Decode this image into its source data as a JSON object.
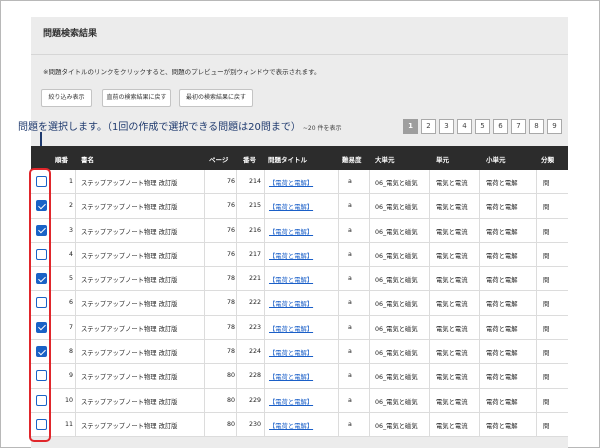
{
  "panel": {
    "title": "問題検索結果",
    "notice": "※問題タイトルのリンクをクリックすると、問題のプレビューが別ウィンドウで表示されます。",
    "buttons": {
      "filter": "絞り込み表示",
      "back_prev": "直前の検索結果に戻す",
      "back_first": "最初の検索結果に戻す"
    }
  },
  "callout": {
    "text": "問題を選択します。（1回の作成で選択できる問題は20問まで）",
    "count": "~20 件を表示"
  },
  "pager": [
    "1",
    "2",
    "3",
    "4",
    "5",
    "6",
    "7",
    "8",
    "9"
  ],
  "pager_active": "1",
  "table": {
    "headers": {
      "no": "順番",
      "book": "書名",
      "page": "ページ",
      "num": "番号",
      "title": "問題タイトル",
      "diff": "難易度",
      "major": "大単元",
      "unit": "単元",
      "minor": "小単元",
      "cls": "分類"
    },
    "rows": [
      {
        "checked": false,
        "no": "1",
        "book": "ステップアップノート物理 改訂版",
        "page": "76",
        "num": "214",
        "title": "【電荷と電解】",
        "diff": "a",
        "major": "06_電気と磁気",
        "unit": "電気と電流",
        "minor": "電荷と電解",
        "cls": "問"
      },
      {
        "checked": true,
        "no": "2",
        "book": "ステップアップノート物理 改訂版",
        "page": "76",
        "num": "215",
        "title": "【電荷と電解】",
        "diff": "a",
        "major": "06_電気と磁気",
        "unit": "電気と電流",
        "minor": "電荷と電解",
        "cls": "問"
      },
      {
        "checked": true,
        "no": "3",
        "book": "ステップアップノート物理 改訂版",
        "page": "76",
        "num": "216",
        "title": "【電荷と電解】",
        "diff": "a",
        "major": "06_電気と磁気",
        "unit": "電気と電流",
        "minor": "電荷と電解",
        "cls": "問"
      },
      {
        "checked": false,
        "no": "4",
        "book": "ステップアップノート物理 改訂版",
        "page": "76",
        "num": "217",
        "title": "【電荷と電解】",
        "diff": "a",
        "major": "06_電気と磁気",
        "unit": "電気と電流",
        "minor": "電荷と電解",
        "cls": "問"
      },
      {
        "checked": true,
        "no": "5",
        "book": "ステップアップノート物理 改訂版",
        "page": "78",
        "num": "221",
        "title": "【電荷と電解】",
        "diff": "a",
        "major": "06_電気と磁気",
        "unit": "電気と電流",
        "minor": "電荷と電解",
        "cls": "問"
      },
      {
        "checked": false,
        "no": "6",
        "book": "ステップアップノート物理 改訂版",
        "page": "78",
        "num": "222",
        "title": "【電荷と電解】",
        "diff": "a",
        "major": "06_電気と磁気",
        "unit": "電気と電流",
        "minor": "電荷と電解",
        "cls": "問"
      },
      {
        "checked": true,
        "no": "7",
        "book": "ステップアップノート物理 改訂版",
        "page": "78",
        "num": "223",
        "title": "【電荷と電解】",
        "diff": "a",
        "major": "06_電気と磁気",
        "unit": "電気と電流",
        "minor": "電荷と電解",
        "cls": "問"
      },
      {
        "checked": true,
        "no": "8",
        "book": "ステップアップノート物理 改訂版",
        "page": "78",
        "num": "224",
        "title": "【電荷と電解】",
        "diff": "a",
        "major": "06_電気と磁気",
        "unit": "電気と電流",
        "minor": "電荷と電解",
        "cls": "問"
      },
      {
        "checked": false,
        "no": "9",
        "book": "ステップアップノート物理 改訂版",
        "page": "80",
        "num": "228",
        "title": "【電荷と電解】",
        "diff": "a",
        "major": "06_電気と磁気",
        "unit": "電気と電流",
        "minor": "電荷と電解",
        "cls": "問"
      },
      {
        "checked": false,
        "no": "10",
        "book": "ステップアップノート物理 改訂版",
        "page": "80",
        "num": "229",
        "title": "【電荷と電解】",
        "diff": "a",
        "major": "06_電気と磁気",
        "unit": "電気と電流",
        "minor": "電荷と電解",
        "cls": "問"
      },
      {
        "checked": false,
        "no": "11",
        "book": "ステップアップノート物理 改訂版",
        "page": "80",
        "num": "230",
        "title": "【電荷と電解】",
        "diff": "a",
        "major": "06_電気と磁気",
        "unit": "電気と電流",
        "minor": "電荷と電解",
        "cls": "問"
      }
    ]
  },
  "colors": {
    "checkbox": "#1a62c6",
    "highlight_box": "#e0262b",
    "header_bg": "#2c2c2c",
    "link": "#1a5fc8"
  }
}
